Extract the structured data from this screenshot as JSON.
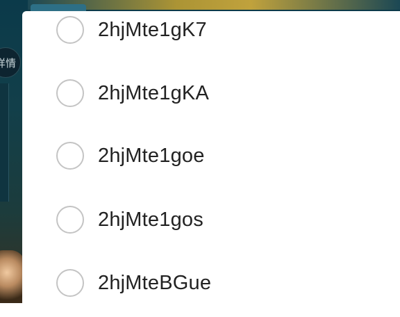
{
  "background": {
    "detail_button_label": "详情"
  },
  "options": [
    {
      "label": "2hjMte1gK7",
      "selected": false
    },
    {
      "label": "2hjMte1gKA",
      "selected": false
    },
    {
      "label": "2hjMte1goe",
      "selected": false
    },
    {
      "label": "2hjMte1gos",
      "selected": false
    },
    {
      "label": "2hjMteBGue",
      "selected": false
    }
  ]
}
